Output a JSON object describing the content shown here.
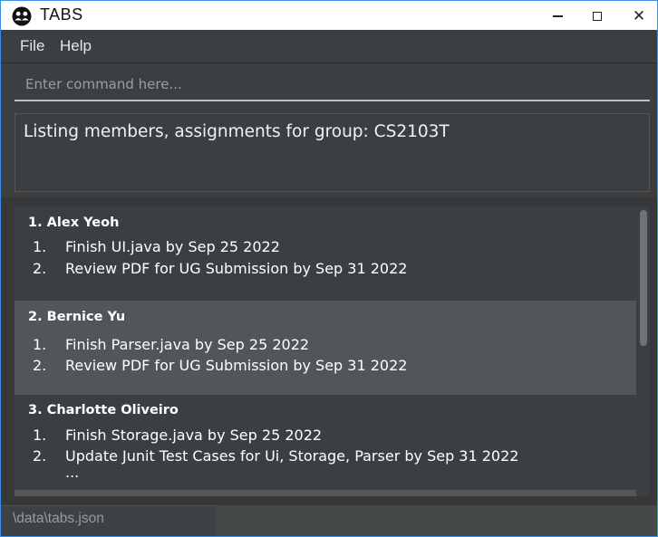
{
  "window": {
    "title": "TABS",
    "app_icon": "people-group-icon",
    "controls": {
      "minimize": "minimize-icon",
      "maximize": "maximize-icon",
      "close": "close-icon",
      "close_glyph": "✕"
    }
  },
  "menu": {
    "items": [
      {
        "label": "File"
      },
      {
        "label": "Help"
      }
    ]
  },
  "command": {
    "placeholder": "Enter command here...",
    "value": ""
  },
  "result": {
    "message": "Listing members, assignments for group: CS2103T"
  },
  "members": [
    {
      "index": "1.",
      "name": "Alex Yeoh",
      "tasks": [
        {
          "num": "1.",
          "text": "Finish UI.java by Sep 25 2022"
        },
        {
          "num": "2.",
          "text": "Review PDF for UG Submission by Sep 31 2022"
        }
      ]
    },
    {
      "index": "2.",
      "name": "Bernice Yu",
      "tasks": [
        {
          "num": "1.",
          "text": "Finish Parser.java by Sep 25 2022"
        },
        {
          "num": "2.",
          "text": "Review PDF for UG Submission by Sep 31 2022"
        }
      ]
    },
    {
      "index": "3.",
      "name": "Charlotte Oliveiro",
      "tasks": [
        {
          "num": "1.",
          "text": "Finish Storage.java by Sep 25 2022"
        },
        {
          "num": "2.",
          "text": "Update Junit Test Cases for Ui, Storage, Parser by Sep 31 2022"
        }
      ],
      "more": "..."
    }
  ],
  "status": {
    "path": "\\data\\tabs.json"
  },
  "colors": {
    "accent_border": "#3a8ee6",
    "panel": "#3c3f41",
    "selected_card": "#515658",
    "text": "#ffffff"
  }
}
